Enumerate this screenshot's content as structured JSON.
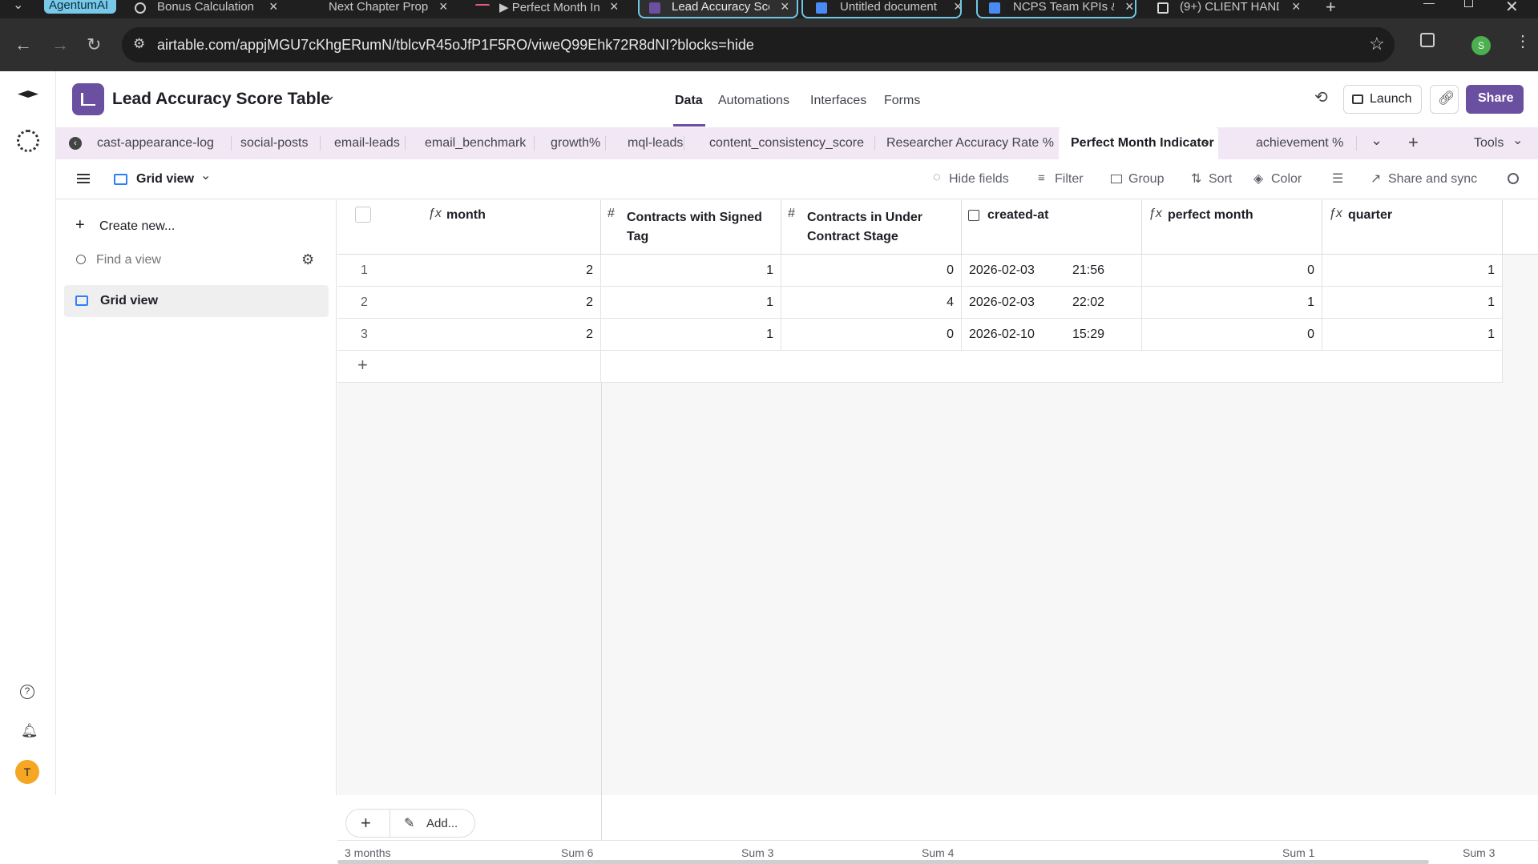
{
  "browser": {
    "tabs": [
      {
        "label": "AgentumAI",
        "kind": "group-chip"
      },
      {
        "label": "Bonus Calculation"
      },
      {
        "label": "Next Chapter Prop"
      },
      {
        "label": "▶ Perfect Month In"
      },
      {
        "label": "Lead Accuracy Sco"
      },
      {
        "label": "Untitled document"
      },
      {
        "label": "NCPS Team KPIs &"
      },
      {
        "label": "(9+) CLIENT HAND"
      }
    ],
    "url": "airtable.com/appjMGU7cKhgERumN/tblcvR45oJfP1F5RO/viweQ99Ehk72R8dNI?blocks=hide",
    "profile_initial": "S",
    "new_tab": "+",
    "close": "×"
  },
  "header": {
    "base_title": "Lead Accuracy Score Table",
    "nav": [
      "Data",
      "Automations",
      "Interfaces",
      "Forms"
    ],
    "launch_label": "Launch",
    "share_label": "Share"
  },
  "tables": {
    "items": [
      "cast-appearance-log",
      "social-posts",
      "email-leads",
      "email_benchmark",
      "growth%",
      "mql-leads",
      "content_consistency_score",
      "Researcher Accuracy Rate %",
      "Perfect Month Indicator",
      "achievement %"
    ],
    "active": "Perfect Month Indicator",
    "tools_label": "Tools"
  },
  "viewbar": {
    "view_name": "Grid view",
    "hide_fields": "Hide fields",
    "filter": "Filter",
    "group": "Group",
    "sort": "Sort",
    "color": "Color",
    "share_sync": "Share and sync"
  },
  "sidebar": {
    "create_new": "Create new...",
    "find_placeholder": "Find a view",
    "views": [
      "Grid view"
    ]
  },
  "grid": {
    "columns": [
      {
        "name": "month",
        "icon": "formula-icon"
      },
      {
        "name": "Contracts with Signed Tag",
        "icon": "number-icon"
      },
      {
        "name": "Contracts in Under Contract Stage",
        "icon": "number-icon"
      },
      {
        "name": "created-at",
        "icon": "created-time-icon"
      },
      {
        "name": "perfect month",
        "icon": "formula-icon"
      },
      {
        "name": "quarter",
        "icon": "formula-icon"
      }
    ],
    "rows": [
      {
        "n": "1",
        "month": "2",
        "signed": "1",
        "under": "0",
        "date": "2026-02-03",
        "time": "21:56",
        "perfect": "0",
        "quarter": "1"
      },
      {
        "n": "2",
        "month": "2",
        "signed": "1",
        "under": "4",
        "date": "2026-02-03",
        "time": "22:02",
        "perfect": "1",
        "quarter": "1"
      },
      {
        "n": "3",
        "month": "2",
        "signed": "1",
        "under": "0",
        "date": "2026-02-10",
        "time": "15:29",
        "perfect": "0",
        "quarter": "1"
      }
    ],
    "add_label": "Add...",
    "footer": {
      "count": "3 months",
      "sums": [
        "Sum 6",
        "Sum 3",
        "Sum 4",
        "Sum 1",
        "Sum 3"
      ]
    }
  },
  "user": {
    "initial": "T"
  },
  "colors": {
    "base_icon": "#6b4fa0",
    "share_button": "#6b4fa0",
    "tables_bar": "#f2e7f5",
    "avatar": "#f5a623"
  }
}
